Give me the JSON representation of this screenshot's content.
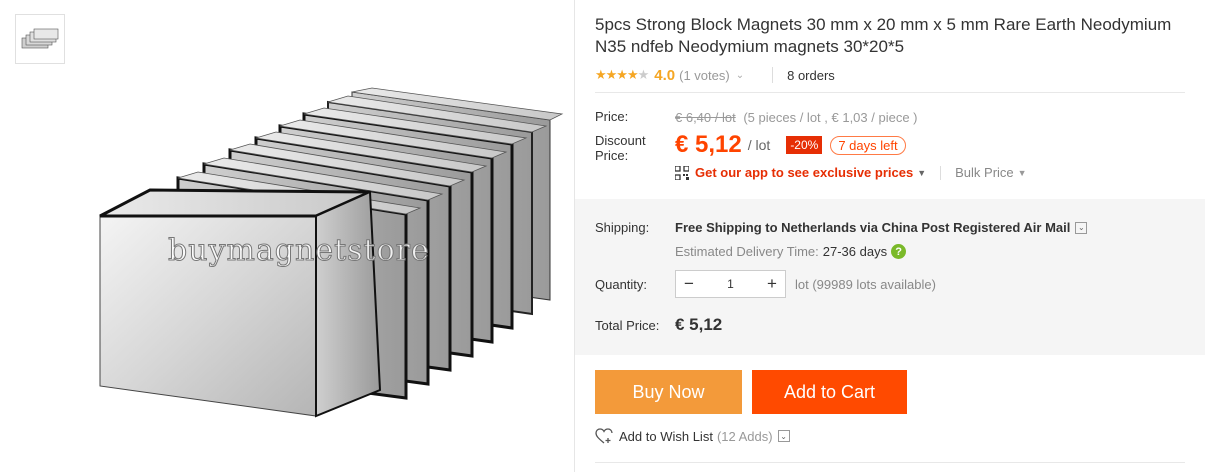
{
  "product": {
    "title": "5pcs Strong Block Magnets 30 mm x 20 mm x 5 mm Rare Earth Neodymium N35 ndfeb Neodymium magnets 30*20*5",
    "watermark": "buymagnetstore",
    "rating_stars": 4.0,
    "rating_score": "4.0",
    "rating_votes": "(1 votes)",
    "orders": "8 orders"
  },
  "pricing": {
    "price_label": "Price:",
    "original_price": "€ 6,40 / lot",
    "original_detail": "(5 pieces / lot , € 1,03 / piece )",
    "discount_label_line1": "Discount",
    "discount_label_line2": "Price:",
    "discount_price": "€ 5,12",
    "discount_unit": "/ lot",
    "discount_percent": "-20%",
    "days_left": "7 days left",
    "app_promo": "Get our app to see exclusive prices",
    "bulk_price": "Bulk Price"
  },
  "shipping": {
    "label": "Shipping:",
    "method": "Free Shipping to Netherlands via China Post Registered Air Mail",
    "est_label": "Estimated Delivery Time:",
    "est_days": "27-36 days",
    "help": "?"
  },
  "quantity": {
    "label": "Quantity:",
    "minus": "−",
    "value": "1",
    "plus": "+",
    "note": "lot (99989 lots available)"
  },
  "total": {
    "label": "Total Price:",
    "value": "€ 5,12"
  },
  "actions": {
    "buy_now": "Buy Now",
    "add_to_cart": "Add to Cart",
    "wishlist": "Add to Wish List",
    "wishlist_count": "(12 Adds)"
  },
  "colors": {
    "accent": "#ff4400",
    "buy_now_bg": "#f39a3a",
    "add_cart_bg": "#ff4a00",
    "star": "#f5a623",
    "help": "#7ab929"
  }
}
